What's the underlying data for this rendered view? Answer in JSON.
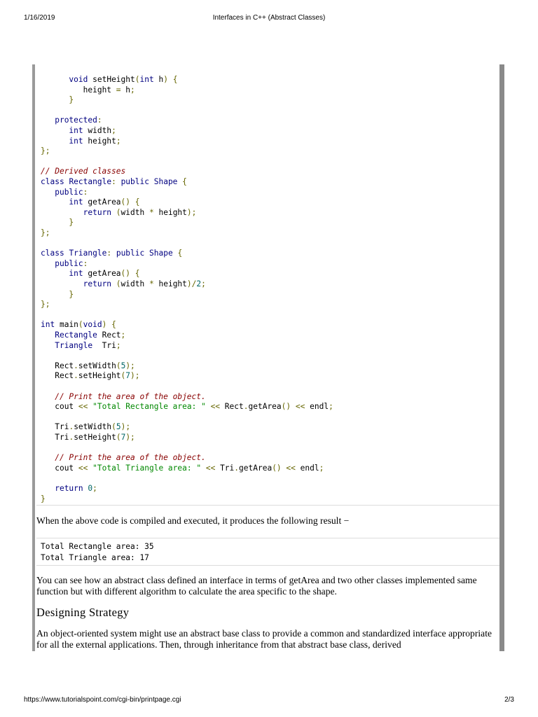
{
  "header": {
    "date": "1/16/2019",
    "title": "Interfaces in C++ (Abstract Classes)"
  },
  "footer": {
    "url": "https://www.tutorialspoint.com/cgi-bin/printpage.cgi",
    "page": "2/3"
  },
  "code": [
    "      void setHeight(int h) {",
    "         height = h;",
    "      }",
    "",
    "   protected:",
    "      int width;",
    "      int height;",
    "};",
    "",
    "// Derived classes",
    "class Rectangle: public Shape {",
    "   public:",
    "      int getArea() {",
    "         return (width * height);",
    "      }",
    "};",
    "",
    "class Triangle: public Shape {",
    "   public:",
    "      int getArea() {",
    "         return (width * height)/2;",
    "      }",
    "};",
    "",
    "int main(void) {",
    "   Rectangle Rect;",
    "   Triangle  Tri;",
    "",
    "   Rect.setWidth(5);",
    "   Rect.setHeight(7);",
    "",
    "   // Print the area of the object.",
    "   cout << \"Total Rectangle area: \" << Rect.getArea() << endl;",
    "",
    "   Tri.setWidth(5);",
    "   Tri.setHeight(7);",
    "",
    "   // Print the area of the object.",
    "   cout << \"Total Triangle area: \" << Tri.getArea() << endl;",
    "",
    "   return 0;",
    "}"
  ],
  "result_intro": "When the above code is compiled and executed, it produces the following result −",
  "output": [
    "Total Rectangle area: 35",
    "Total Triangle area: 17"
  ],
  "explanation": "You can see how an abstract class defined an interface in terms of getArea and two other classes implemented same function but with different algorithm to calculate the area specific to the shape.",
  "section_heading": "Designing Strategy",
  "section_paragraph": "An object-oriented system might use an abstract base class to provide a common and standardized interface appropriate for all the external applications. Then, through inheritance from that abstract base class, derived"
}
